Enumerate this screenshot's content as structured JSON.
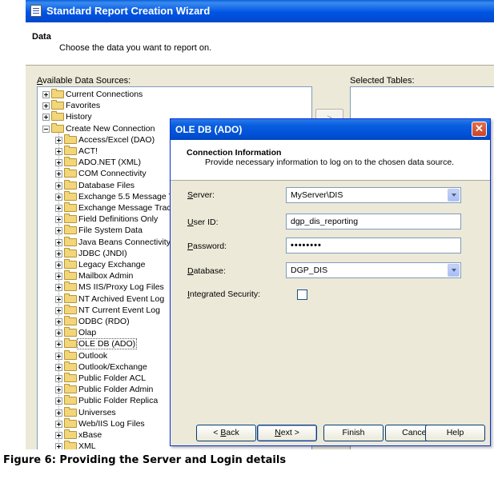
{
  "wizard": {
    "title": "Standard Report Creation Wizard",
    "header_title": "Data",
    "header_desc": "Choose the data you want to report on.",
    "available_label": "Available Data Sources:",
    "selected_label": "Selected Tables:",
    "arrow_label": ">"
  },
  "tree": {
    "top_items": [
      {
        "label": "Current Connections",
        "expanded": false
      },
      {
        "label": "Favorites",
        "expanded": false
      },
      {
        "label": "History",
        "expanded": false
      },
      {
        "label": "Create New Connection",
        "expanded": true
      }
    ],
    "children": [
      "Access/Excel (DAO)",
      "ACT!",
      "ADO.NET (XML)",
      "COM Connectivity",
      "Database Files",
      "Exchange 5.5 Message Tra",
      "Exchange Message Trackin",
      "Field Definitions Only",
      "File System Data",
      "Java Beans Connectivity",
      "JDBC (JNDI)",
      "Legacy Exchange",
      "Mailbox Admin",
      "MS IIS/Proxy Log Files",
      "NT Archived Event Log",
      "NT Current Event Log",
      "ODBC (RDO)",
      "Olap",
      "OLE DB (ADO)",
      "Outlook",
      "Outlook/Exchange",
      "Public Folder ACL",
      "Public Folder Admin",
      "Public Folder Replica",
      "Universes",
      "Web/IIS Log Files",
      "xBase",
      "XML"
    ],
    "selected": "OLE DB (ADO)"
  },
  "dialog": {
    "title": "OLE DB (ADO)",
    "close_glyph": "✕",
    "header_title": "Connection Information",
    "header_desc": "Provide necessary information to log on to the chosen data source.",
    "server_label_key": "S",
    "server_label_rest": "erver:",
    "server_value": "MyServer\\DIS",
    "userid_label_key": "U",
    "userid_label_rest": "ser ID:",
    "userid_value": "dgp_dis_reporting",
    "password_label_key": "P",
    "password_label_rest": "assword:",
    "password_value": "••••••••",
    "database_label_key": "D",
    "database_label_rest": "atabase:",
    "database_value": "DGP_DIS",
    "integrated_label_key": "I",
    "integrated_label_rest": "ntegrated Security:",
    "integrated_checked": false,
    "buttons": {
      "back_pre": "< ",
      "back_key": "B",
      "back_rest": "ack",
      "next_key": "N",
      "next_rest": "ext >",
      "finish": "Finish",
      "cancel": "Cancel",
      "help": "Help"
    }
  },
  "caption": "Figure 6: Providing the Server and Login details"
}
